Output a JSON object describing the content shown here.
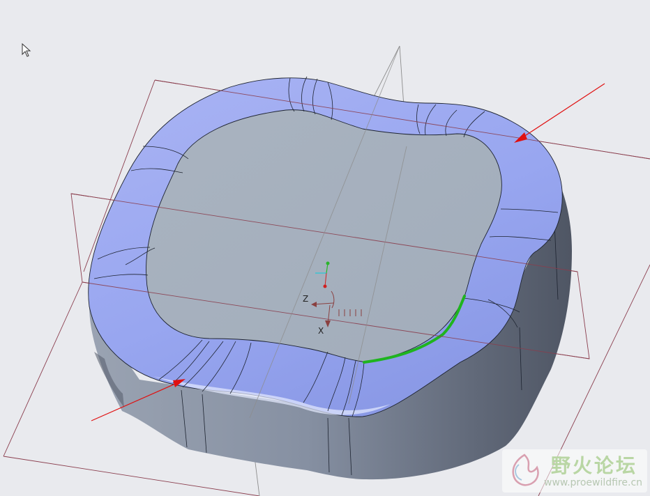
{
  "viewport": {
    "background": "#e9eaee",
    "colors": {
      "top_face": "#a6b1bf",
      "fillet_surface": "#9aa8f2",
      "side_wall": "#7f8899",
      "datum_plane": "#8a3d4d",
      "selected_edge": "#1fb41f",
      "arrow": "#e01010"
    }
  },
  "csys": {
    "z_label": "Z",
    "x_label": "X"
  },
  "watermark": {
    "title": "野火论坛",
    "url": "www.proewildfire.cn"
  },
  "cursor": {
    "icon": "arrow-pointer-icon"
  }
}
